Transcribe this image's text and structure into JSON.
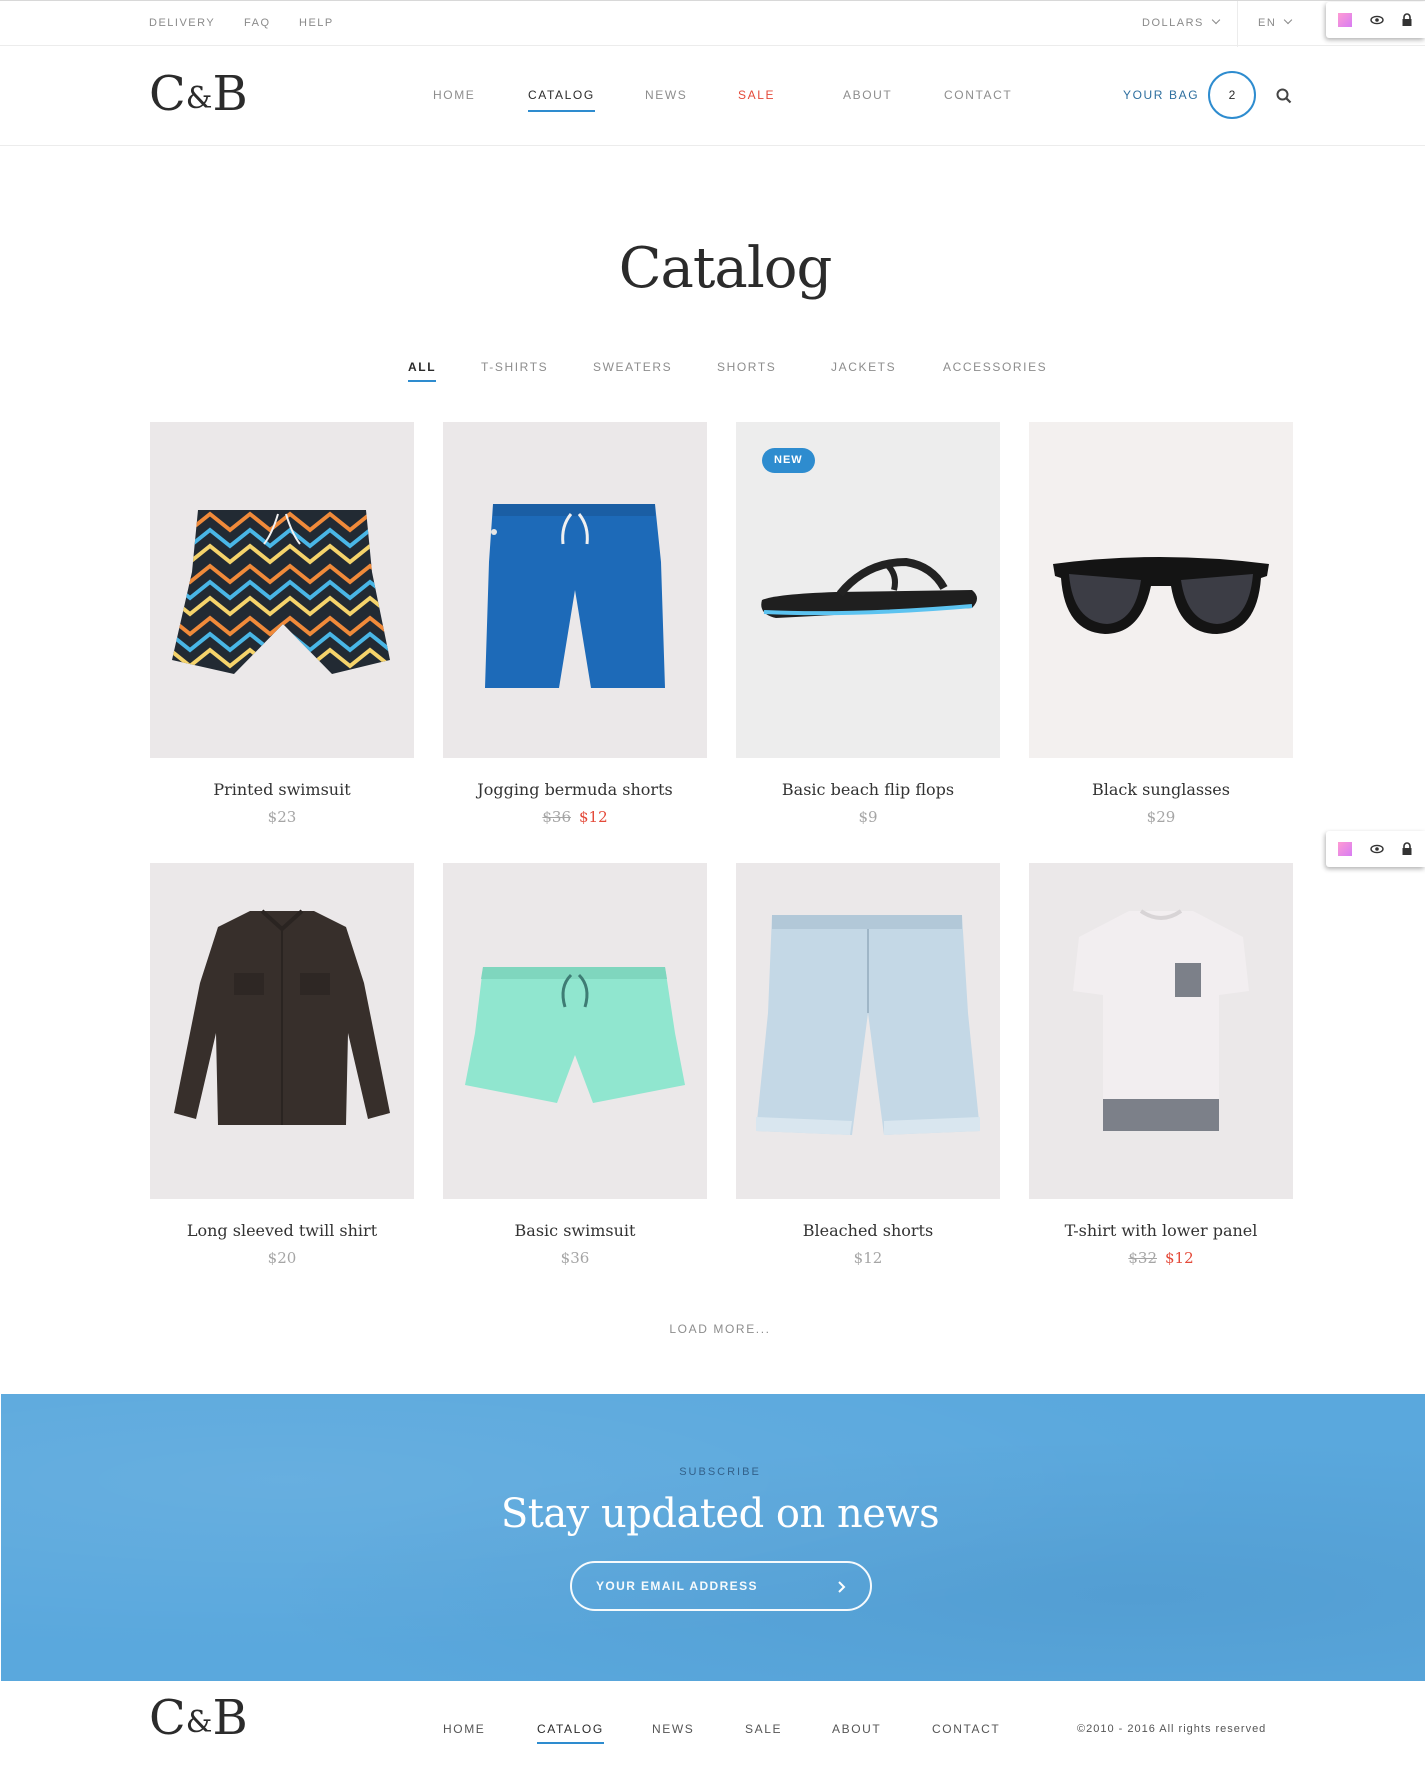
{
  "topbar": {
    "links": [
      "DELIVERY",
      "FAQ",
      "HELP"
    ],
    "currency": "DOLLARS",
    "language": "EN"
  },
  "header": {
    "logo": {
      "left": "C",
      "amp": "&",
      "right": "B"
    },
    "nav": [
      "HOME",
      "CATALOG",
      "NEWS",
      "SALE",
      "ABOUT",
      "CONTACT"
    ],
    "active_nav": "CATALOG",
    "sale_color": "#e44a3a",
    "bag_label": "YOUR BAG",
    "bag_count": "2"
  },
  "page_title": "Catalog",
  "filters": [
    "ALL",
    "T-SHIRTS",
    "SWEATERS",
    "SHORTS",
    "JACKETS",
    "ACCESSORIES"
  ],
  "active_filter": "ALL",
  "products": [
    {
      "name": "Printed swimsuit",
      "price": "$23",
      "old_price": "",
      "new_price": "",
      "badge": ""
    },
    {
      "name": "Jogging bermuda shorts",
      "price": "",
      "old_price": "$36",
      "new_price": "$12",
      "badge": ""
    },
    {
      "name": "Basic beach flip flops",
      "price": "$9",
      "old_price": "",
      "new_price": "",
      "badge": "NEW"
    },
    {
      "name": "Black sunglasses",
      "price": "$29",
      "old_price": "",
      "new_price": "",
      "badge": ""
    },
    {
      "name": "Long sleeved twill shirt",
      "price": "$20",
      "old_price": "",
      "new_price": "",
      "badge": ""
    },
    {
      "name": "Basic swimsuit",
      "price": "$36",
      "old_price": "",
      "new_price": "",
      "badge": ""
    },
    {
      "name": "Bleached shorts",
      "price": "$12",
      "old_price": "",
      "new_price": "",
      "badge": ""
    },
    {
      "name": "T-shirt with lower panel",
      "price": "",
      "old_price": "$32",
      "new_price": "$12",
      "badge": ""
    }
  ],
  "load_more": "LOAD MORE...",
  "subscribe": {
    "kicker": "SUBSCRIBE",
    "title": "Stay updated on news",
    "placeholder": "YOUR EMAIL ADDRESS"
  },
  "footer": {
    "nav": [
      "HOME",
      "CATALOG",
      "NEWS",
      "SALE",
      "ABOUT",
      "CONTACT"
    ],
    "active_nav": "CATALOG",
    "copyright": "©2010 - 2016 All rights reserved"
  },
  "colors": {
    "accent": "#2e8ccf",
    "sale": "#e44a3a",
    "subscribe_bg": "#5aa8dd"
  }
}
